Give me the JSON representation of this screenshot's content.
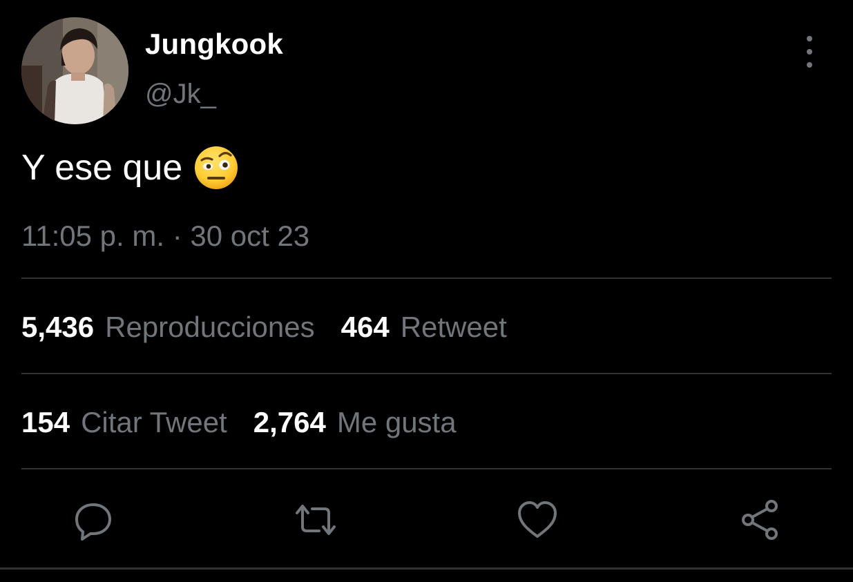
{
  "author": {
    "display_name": "Jungkook",
    "handle": "@Jk_"
  },
  "tweet": {
    "text": "Y ese que",
    "emoji": "face-with-raised-eyebrow"
  },
  "timestamp": {
    "time": "11:05 p. m.",
    "separator": "·",
    "date": "30 oct 23"
  },
  "stats": {
    "views": {
      "count": "5,436",
      "label": "Reproducciones"
    },
    "retweets": {
      "count": "464",
      "label": "Retweet"
    },
    "quotes": {
      "count": "154",
      "label": "Citar Tweet"
    },
    "likes": {
      "count": "2,764",
      "label": "Me gusta"
    }
  },
  "actions": [
    {
      "icon": "reply-icon"
    },
    {
      "icon": "retweet-icon"
    },
    {
      "icon": "like-icon"
    },
    {
      "icon": "share-icon"
    }
  ],
  "colors": {
    "background": "#000000",
    "primary_text": "#ffffff",
    "secondary_text": "#71767b",
    "divider": "#2f3336"
  }
}
